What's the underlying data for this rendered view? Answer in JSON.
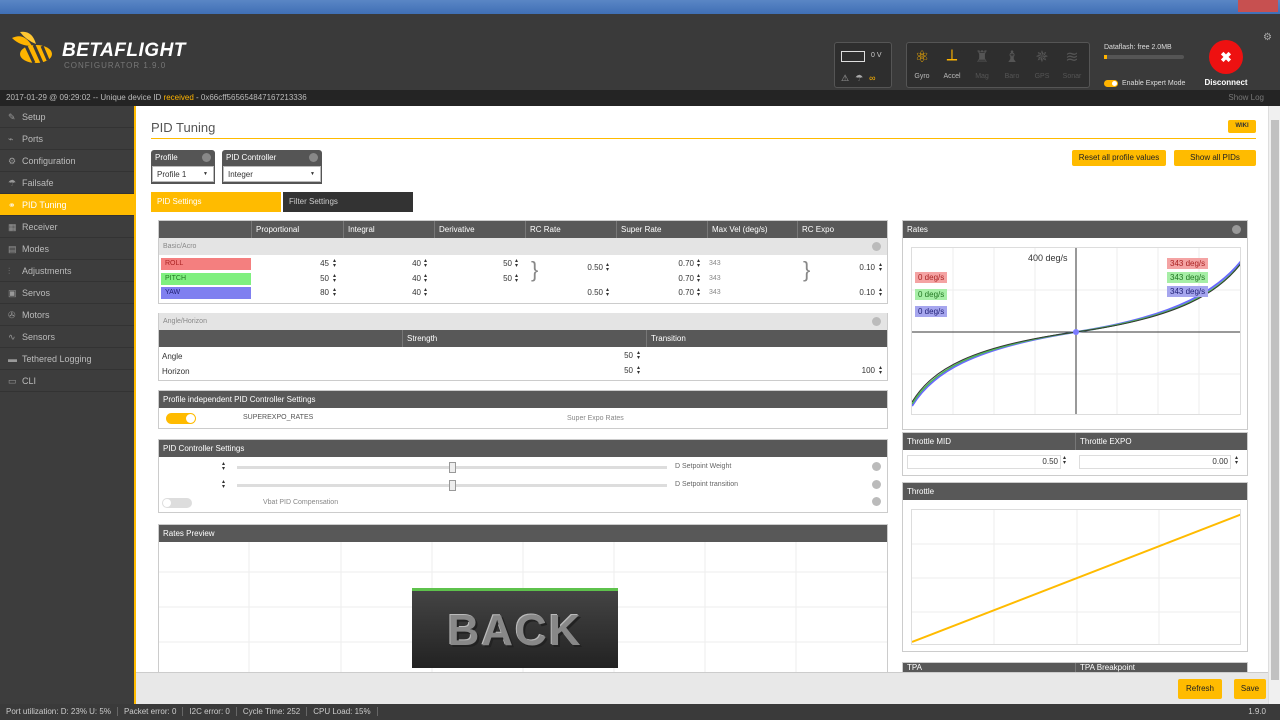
{
  "app": {
    "brand": "BETAFLIGHT",
    "subtitle": "CONFIGURATOR 1.9.0"
  },
  "header": {
    "battery_voltage": "0 V",
    "sensors": [
      {
        "label": "Gyro",
        "icon": "gyro-icon",
        "active": true
      },
      {
        "label": "Accel",
        "icon": "accel-icon",
        "active": true
      },
      {
        "label": "Mag",
        "icon": "mag-icon",
        "active": false
      },
      {
        "label": "Baro",
        "icon": "baro-icon",
        "active": false
      },
      {
        "label": "GPS",
        "icon": "gps-icon",
        "active": false
      },
      {
        "label": "Sonar",
        "icon": "sonar-icon",
        "active": false
      }
    ],
    "dataflash": "Dataflash: free 2.0MB",
    "expert_mode": "Enable Expert Mode",
    "disconnect": "Disconnect"
  },
  "log": {
    "time": "2017-01-29 @ 09:29:02 -- Unique device ID ",
    "status": "received",
    "device": " - 0x66cff565654847167213336",
    "show_log": "Show Log"
  },
  "sidebar": {
    "items": [
      {
        "label": "Setup",
        "icon": "wrench-icon"
      },
      {
        "label": "Ports",
        "icon": "plug-icon"
      },
      {
        "label": "Configuration",
        "icon": "gear-icon"
      },
      {
        "label": "Failsafe",
        "icon": "failsafe-icon"
      },
      {
        "label": "PID Tuning",
        "icon": "pid-icon",
        "active": true
      },
      {
        "label": "Receiver",
        "icon": "receiver-icon"
      },
      {
        "label": "Modes",
        "icon": "modes-icon"
      },
      {
        "label": "Adjustments",
        "icon": "adjustments-icon"
      },
      {
        "label": "Servos",
        "icon": "servos-icon"
      },
      {
        "label": "Motors",
        "icon": "motors-icon"
      },
      {
        "label": "Sensors",
        "icon": "sensors-icon"
      },
      {
        "label": "Tethered Logging",
        "icon": "logging-icon"
      },
      {
        "label": "CLI",
        "icon": "cli-icon"
      }
    ]
  },
  "page": {
    "title": "PID Tuning",
    "wiki": "WIKI",
    "reset": "Reset all profile values",
    "show_all": "Show all PIDs"
  },
  "profile": {
    "label": "Profile",
    "value": "Profile 1"
  },
  "controller": {
    "label": "PID Controller",
    "value": "Integer"
  },
  "tabs": {
    "pid": "PID Settings",
    "filter": "Filter Settings"
  },
  "pid_table": {
    "headers": [
      "Proportional",
      "Integral",
      "Derivative",
      "RC Rate",
      "Super Rate",
      "Max Vel (deg/s)",
      "RC Expo"
    ],
    "section": "Basic/Acro",
    "rows": [
      {
        "name": "ROLL",
        "p": "45",
        "i": "40",
        "d": "50",
        "super": "0.70",
        "maxvel": "343"
      },
      {
        "name": "PITCH",
        "p": "50",
        "i": "40",
        "d": "50",
        "super": "0.70",
        "maxvel": "343"
      },
      {
        "name": "YAW",
        "p": "80",
        "i": "40",
        "d": "",
        "super": "0.70",
        "maxvel": "343"
      }
    ],
    "rc_rate_rollpitch": "0.50",
    "rc_rate_yaw": "0.50",
    "rc_expo_rollpitch": "0.10",
    "rc_expo_yaw": "0.10"
  },
  "angle": {
    "section": "Angle/Horizon",
    "strength": "Strength",
    "transition": "Transition",
    "angle_label": "Angle",
    "angle_strength": "50",
    "horizon_label": "Horizon",
    "horizon_strength": "50",
    "horizon_transition": "100"
  },
  "indep": {
    "title": "Profile independent PID Controller Settings",
    "name": "SUPEREXPO_RATES",
    "desc": "Super Expo Rates"
  },
  "ctrl_settings": {
    "title": "PID Controller Settings",
    "d_weight": "D Setpoint Weight",
    "d_transition": "D Setpoint transition",
    "vbat": "Vbat PID Compensation"
  },
  "rates_preview": {
    "title": "Rates Preview"
  },
  "overlay": {
    "text": "BACK"
  },
  "rates": {
    "title": "Rates",
    "max_label": "400 deg/s",
    "left_labels": [
      "0 deg/s",
      "0 deg/s",
      "0 deg/s"
    ],
    "right_labels": [
      "343 deg/s",
      "343 deg/s",
      "343 deg/s"
    ],
    "colors": {
      "roll": "#f4a3a3",
      "pitch": "#a6eea6",
      "yaw": "#a6a6ee"
    }
  },
  "throttle": {
    "mid_label": "Throttle MID",
    "expo_label": "Throttle EXPO",
    "mid": "0.50",
    "expo": "0.00",
    "title": "Throttle"
  },
  "tpa": {
    "label": "TPA",
    "breakpoint": "TPA Breakpoint"
  },
  "actions": {
    "refresh": "Refresh",
    "save": "Save"
  },
  "status": {
    "port": "Port utilization: D: 23% U: 5%",
    "packet": "Packet error: 0",
    "i2c": "I2C error: 0",
    "cycle": "Cycle Time: 252",
    "cpu": "CPU Load: 15%",
    "version": "1.9.0"
  },
  "accent": "#ffbb00"
}
